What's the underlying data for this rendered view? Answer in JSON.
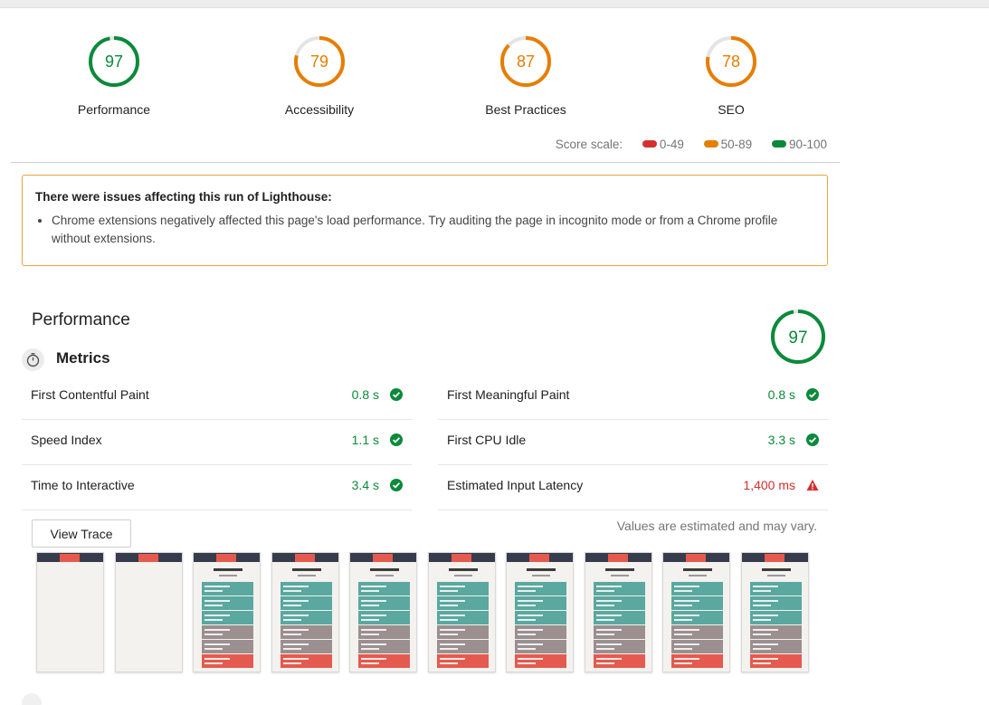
{
  "categories": [
    {
      "label": "Performance",
      "score": 97,
      "color": "#0a8a3a"
    },
    {
      "label": "Accessibility",
      "score": 79,
      "color": "#e67e00"
    },
    {
      "label": "Best Practices",
      "score": 87,
      "color": "#e67e00"
    },
    {
      "label": "SEO",
      "score": 78,
      "color": "#e67e00"
    }
  ],
  "score_scale": {
    "label": "Score scale:",
    "ranges": [
      {
        "range": "0-49",
        "color": "#d32f2f"
      },
      {
        "range": "50-89",
        "color": "#e67e00"
      },
      {
        "range": "90-100",
        "color": "#0a8a3a"
      }
    ]
  },
  "warning": {
    "title": "There were issues affecting this run of Lighthouse:",
    "items": [
      "Chrome extensions negatively affected this page's load performance. Try auditing the page in incognito mode or from a Chrome profile without extensions."
    ]
  },
  "performance": {
    "title": "Performance",
    "score": 97,
    "color": "#0a8a3a",
    "metrics_title": "Metrics",
    "metrics": [
      {
        "name": "First Contentful Paint",
        "value": "0.8 s",
        "status": "pass"
      },
      {
        "name": "First Meaningful Paint",
        "value": "0.8 s",
        "status": "pass"
      },
      {
        "name": "Speed Index",
        "value": "1.1 s",
        "status": "pass"
      },
      {
        "name": "First CPU Idle",
        "value": "3.3 s",
        "status": "pass"
      },
      {
        "name": "Time to Interactive",
        "value": "3.4 s",
        "status": "pass"
      },
      {
        "name": "Estimated Input Latency",
        "value": "1,400 ms",
        "status": "fail"
      }
    ],
    "view_trace_label": "View Trace",
    "estimate_note": "Values are estimated and may vary."
  },
  "icons": {
    "metrics": "stopwatch-icon",
    "pass": "check-circle-icon",
    "fail": "warning-triangle-icon"
  },
  "filmstrip": {
    "frames": [
      {
        "state": "blank"
      },
      {
        "state": "blank"
      },
      {
        "state": "loaded"
      },
      {
        "state": "loaded"
      },
      {
        "state": "loaded"
      },
      {
        "state": "loaded"
      },
      {
        "state": "loaded"
      },
      {
        "state": "loaded"
      },
      {
        "state": "loaded"
      },
      {
        "state": "loaded"
      }
    ]
  }
}
